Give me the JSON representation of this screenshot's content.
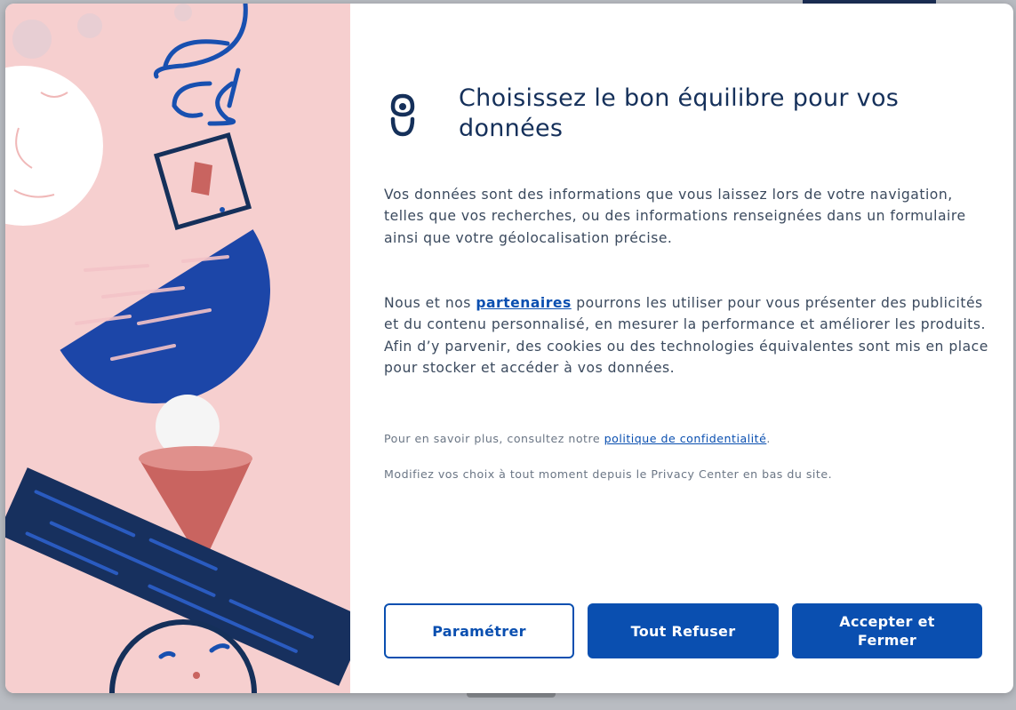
{
  "dialog": {
    "title": "Choisissez le bon équilibre pour vos données",
    "paragraph1": "Vos données sont des informations que vous laissez lors de votre navigation, telles que vos recherches, ou des informations renseignées dans un formulaire ainsi que votre géolocalisation précise.",
    "paragraph2": {
      "before": "Nous et nos ",
      "link": "partenaires",
      "after": " pourrons les utiliser pour vous présenter des publicités et du contenu personnalisé, en mesurer la performance et améliorer les produits. Afin d’y parvenir, des cookies ou des technologies équivalentes sont mis en place pour stocker et accéder à vos données."
    },
    "privacy": {
      "before": "Pour en savoir plus, consultez notre ",
      "link": "politique de confidentialité",
      "after": "."
    },
    "note": "Modifiez vos choix à tout moment depuis le Privacy Center en bas du site.",
    "buttons": {
      "settings": "Paramétrer",
      "refuse": "Tout Refuser",
      "accept": "Accepter et Fermer"
    }
  },
  "icons": {
    "logo": "link-shield-icon",
    "illustration": "balance-illustration"
  },
  "colors": {
    "brand": "#0a4fb0",
    "title": "#15305a",
    "illustration_bg": "#f6cfcf"
  }
}
